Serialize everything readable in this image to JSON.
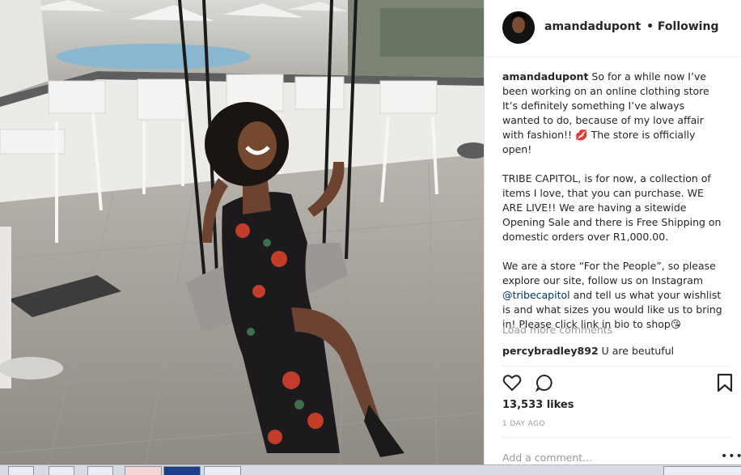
{
  "post": {
    "username": "amandadupont",
    "follow_status": "• Following",
    "caption_user": "amandadupont",
    "caption_p1": " So for a while now I’ve been working on an online clothing store⁣ It’s definitely something I’ve always wanted to do, because of my love affair with fashion!! 💋 The store is officially open!",
    "caption_p2": "TRIBE CAPITOL, is for now, a collection of items I love, that you can purchase. WE ARE LIVE!! We are having a sitewide Opening Sale and there is Free Shipping on domestic orders over R1,000.00.",
    "caption_p3_a": "We are a store “For the People”, so please explore our site, follow us on Instagram ",
    "caption_mention": "@tribecapitol",
    "caption_p3_b": " and tell us what your wishlist is and what sizes you would like us to bring in! Please click link in bio to shop😘",
    "load_more": "Load more comments",
    "comment_user": "percybradley892",
    "comment_text": " U are beutuful",
    "likes": "13,533 likes",
    "time_ago": "1 DAY AGO",
    "add_comment_placeholder": "Add a comment...",
    "more_options": "•••"
  },
  "icons": [
    "heart-icon",
    "comment-icon",
    "bookmark-icon",
    "more-options-icon"
  ],
  "colors": {
    "text": "#262626",
    "muted": "#999999",
    "link": "#003569",
    "border": "#efefef"
  }
}
